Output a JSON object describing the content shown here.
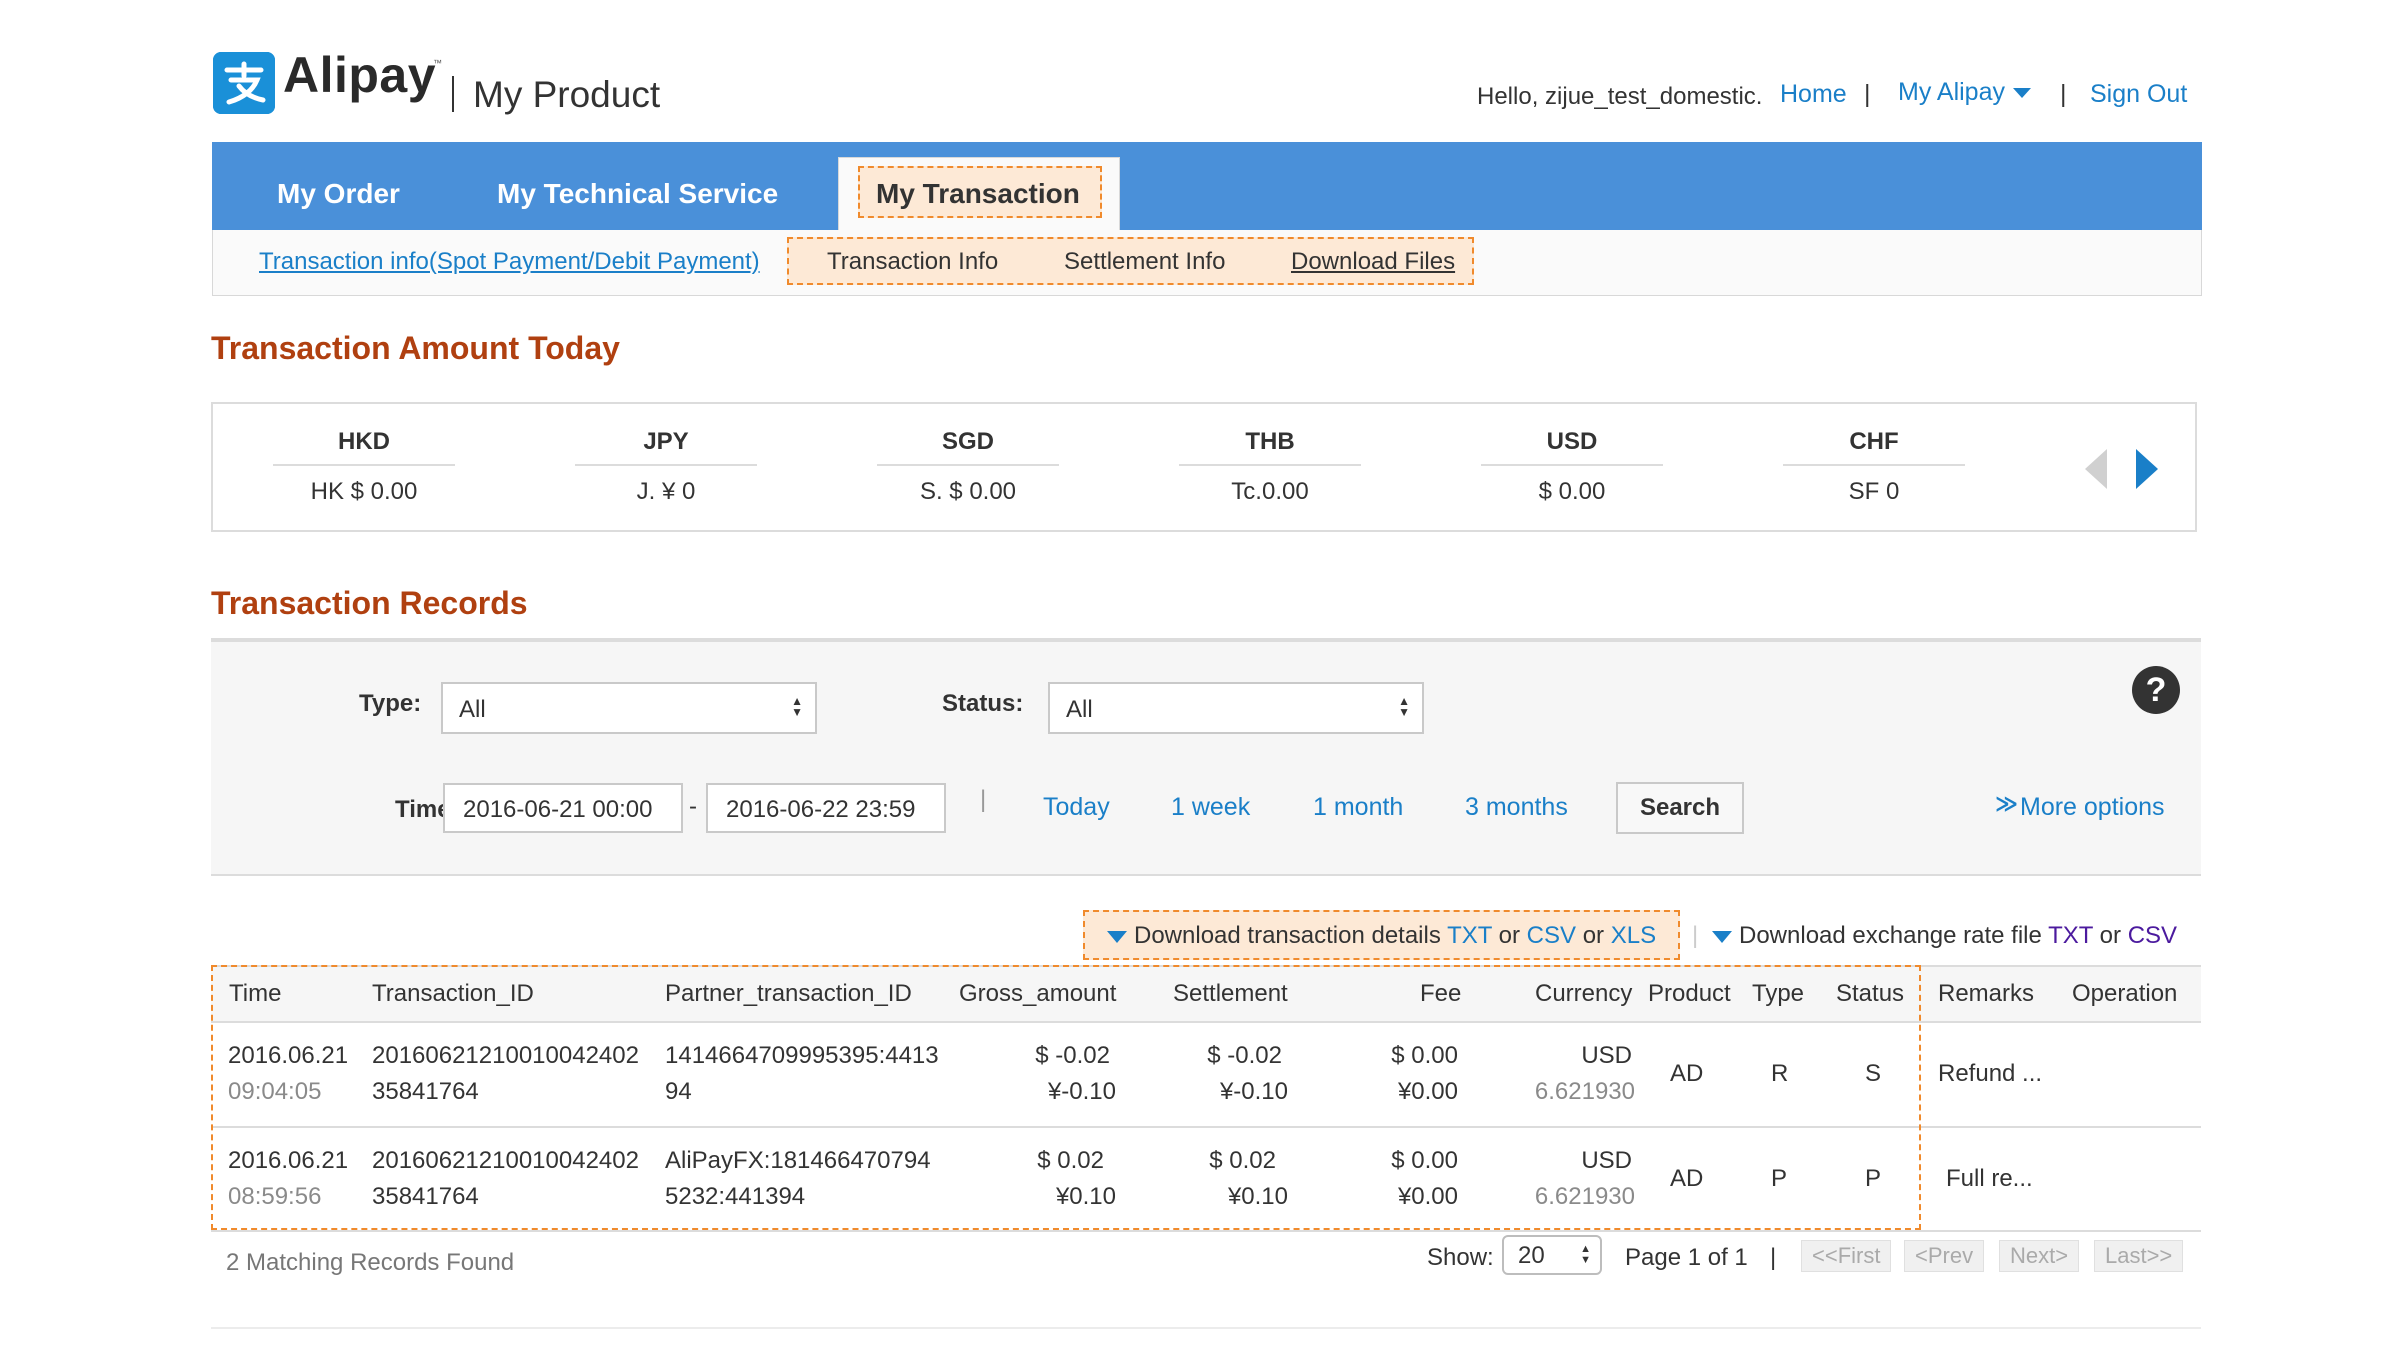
{
  "header": {
    "logo_text": "Alipay",
    "logo_tm": "™",
    "product_title": "My Product",
    "greeting": "Hello, zijue_test_domestic.",
    "home": "Home",
    "sep": "|",
    "my_alipay": "My Alipay",
    "sign_out": "Sign Out"
  },
  "tabs": {
    "my_order": "My Order",
    "my_technical_service": "My Technical Service",
    "my_transaction": "My Transaction"
  },
  "subtabs": {
    "spot_link": "Transaction info(Spot Payment/Debit Payment)",
    "transaction_info": "Transaction Info",
    "settlement_info": "Settlement Info",
    "download_files": "Download Files"
  },
  "amount_today": {
    "title": "Transaction Amount Today",
    "currencies": [
      {
        "code": "HKD",
        "amount": "HK $  0.00"
      },
      {
        "code": "JPY",
        "amount": "J. ¥  0"
      },
      {
        "code": "SGD",
        "amount": "S. $  0.00"
      },
      {
        "code": "THB",
        "amount": "Tc.0.00"
      },
      {
        "code": "USD",
        "amount": "$ 0.00"
      },
      {
        "code": "CHF",
        "amount": "SF 0"
      }
    ]
  },
  "records": {
    "title": "Transaction Records",
    "filters": {
      "type_label": "Type:",
      "type_value": "All",
      "status_label": "Status:",
      "status_value": "All",
      "time_label": "Time:",
      "time_from": "2016-06-21 00:00",
      "time_dash": "-",
      "time_to": "2016-06-22 23:59",
      "quick_sep": "|",
      "quick": [
        "Today",
        "1 week",
        "1 month",
        "3 months"
      ],
      "search": "Search",
      "more_options": "More options",
      "help": "?"
    },
    "downloads": {
      "details_prefix": "Download transaction details",
      "txt": "TXT",
      "or": "or",
      "csv": "CSV",
      "xls": "XLS",
      "sep": "|",
      "rate_prefix": "Download exchange rate file"
    },
    "columns": [
      "Time",
      "Transaction_ID",
      "Partner_transaction_ID",
      "Gross_amount",
      "Settlement",
      "Fee",
      "Currency",
      "Product",
      "Type",
      "Status",
      "Remarks",
      "Operation"
    ],
    "rows": [
      {
        "date": "2016.06.21",
        "time": "09:04:05",
        "txn_id_1": "20160621210010042402",
        "txn_id_2": "35841764",
        "partner_1": "1414664709995395:4413",
        "partner_2": "94",
        "gross_1": "$ -0.02",
        "gross_2": "¥-0.10",
        "settle_1": "$ -0.02",
        "settle_2": "¥-0.10",
        "fee_1": "$ 0.00",
        "fee_2": "¥0.00",
        "currency": "USD",
        "rate": "6.621930",
        "product": "AD",
        "type": "R",
        "status": "S",
        "remarks": "Refund ..."
      },
      {
        "date": "2016.06.21",
        "time": "08:59:56",
        "txn_id_1": "20160621210010042402",
        "txn_id_2": "35841764",
        "partner_1": "AliPayFX:181466470794",
        "partner_2": "5232:441394",
        "gross_1": "$ 0.02",
        "gross_2": "¥0.10",
        "settle_1": "$ 0.02",
        "settle_2": "¥0.10",
        "fee_1": "$ 0.00",
        "fee_2": "¥0.00",
        "currency": "USD",
        "rate": "6.621930",
        "product": "AD",
        "type": "P",
        "status": "P",
        "remarks": "Full re..."
      }
    ],
    "footer": {
      "found": "2 Matching Records Found",
      "show_label": "Show:",
      "show_value": "20",
      "page_info": "Page 1 of 1",
      "sep": "|",
      "first": "<<First",
      "prev": "<Prev",
      "next": "Next>",
      "last": "Last>>"
    }
  },
  "colors": {
    "accent_blue": "#4a90d9",
    "link_blue": "#1a7fc8",
    "heading_brown": "#b04010",
    "highlight_orange": "#f08a2c",
    "purple_link": "#4b1a9e"
  }
}
